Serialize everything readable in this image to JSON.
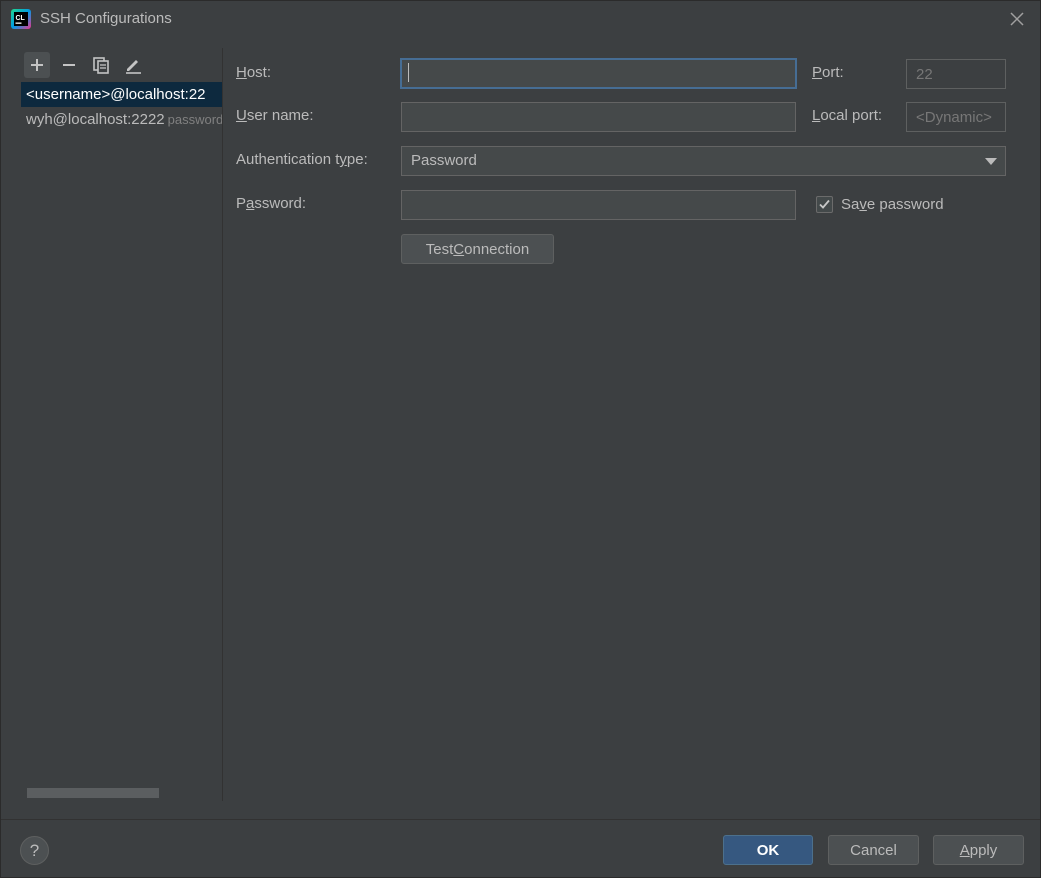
{
  "window": {
    "title": "SSH Configurations",
    "app_icon": "clion-icon"
  },
  "toolbar": {
    "add": "plus-icon",
    "remove": "minus-icon",
    "copy": "copy-icon",
    "edit": "pencil-icon"
  },
  "configs": [
    {
      "label": "<username>@localhost:22",
      "hint": "",
      "selected": true
    },
    {
      "label": "wyh@localhost:2222",
      "hint": "password",
      "selected": false
    }
  ],
  "form": {
    "host_label": "Host:",
    "host_value": "",
    "port_label": "Port:",
    "port_value": "22",
    "username_label": "User name:",
    "username_value": "",
    "local_port_label": "Local port:",
    "local_port_placeholder": "<Dynamic>",
    "auth_type_label": "Authentication type:",
    "auth_type_value": "Password",
    "password_label": "Password:",
    "password_value": "",
    "save_password_label": "Save password",
    "save_password_checked": true,
    "test_connection_label": "Test Connection"
  },
  "footer": {
    "help_label": "?",
    "ok_label": "OK",
    "cancel_label": "Cancel",
    "apply_label": "Apply"
  },
  "colors": {
    "background": "#3c3f41",
    "selection": "#0d293e",
    "primary_button": "#365880",
    "focus_border": "#466d94"
  }
}
